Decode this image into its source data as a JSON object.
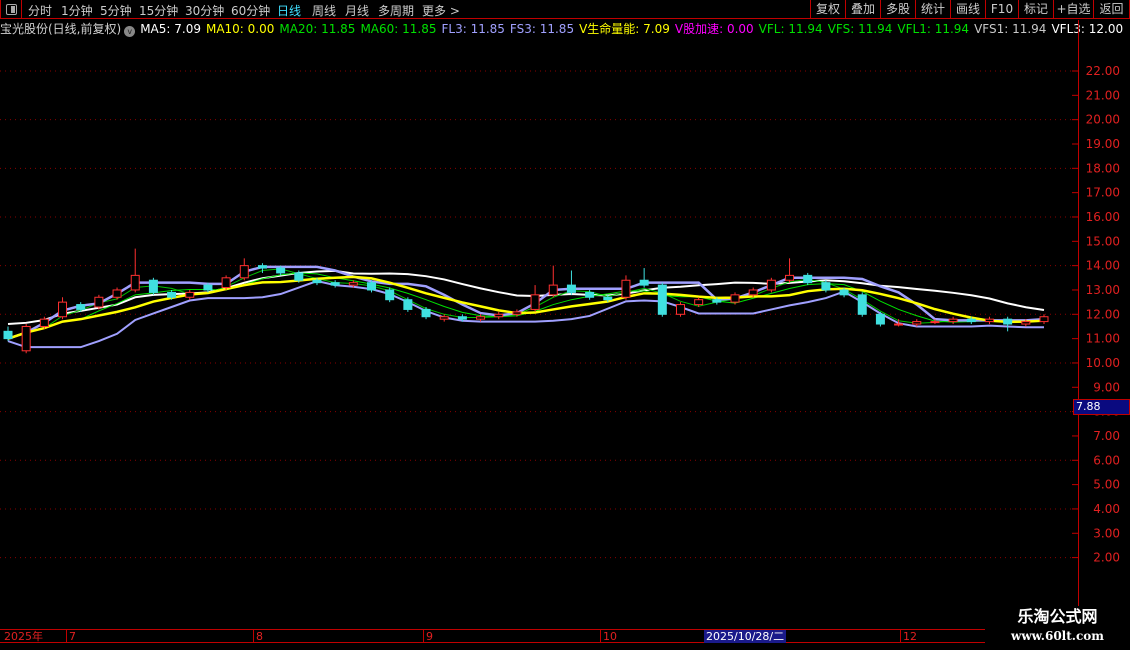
{
  "toolbar": {
    "periods": [
      "分时",
      "1分钟",
      "5分钟",
      "15分钟",
      "30分钟",
      "60分钟",
      "日线",
      "周线",
      "月线",
      "多周期",
      "更多 >"
    ],
    "active_period": "日线",
    "right_buttons": [
      "复权",
      "叠加",
      "多股",
      "统计",
      "画线",
      "F10",
      "标记",
      "+自选",
      "返回"
    ]
  },
  "info": {
    "title": "宝光股份(日线,前复权)",
    "indicators": [
      {
        "text": "MA5: 7.09",
        "color": "#ffffff"
      },
      {
        "text": "MA10: 0.00",
        "color": "#ffff00"
      },
      {
        "text": "MA20: 11.85",
        "color": "#00e000"
      },
      {
        "text": "MA60: 11.85",
        "color": "#00e000"
      },
      {
        "text": "FL3: 11.85",
        "color": "#a0a0ff"
      },
      {
        "text": "FS3: 11.85",
        "color": "#a0a0ff"
      },
      {
        "text": "V生命量能: 7.09",
        "color": "#ffff00"
      },
      {
        "text": "V股加速: 0.00",
        "color": "#ff00ff"
      },
      {
        "text": "VFL: 11.94",
        "color": "#00e000"
      },
      {
        "text": "VFS: 11.94",
        "color": "#00e000"
      },
      {
        "text": "VFL1: 11.94",
        "color": "#00e000"
      },
      {
        "text": "VFS1: 11.94",
        "color": "#c8c8c8"
      },
      {
        "text": "VFL3: 12.00",
        "color": "#ffffff"
      }
    ]
  },
  "last_price": "7.88",
  "dates": {
    "year": "2025年",
    "months": [
      "7",
      "8",
      "9",
      "10",
      "12"
    ],
    "cursor": "2025/10/28/二"
  },
  "watermark": {
    "title": "乐淘公式网",
    "url": "www.60lt.com"
  },
  "colors": {
    "up": "#ff3030",
    "down": "#40e0e0",
    "ma": "#ffff00",
    "band": "#a0a0ff",
    "axis": "#e02020"
  },
  "chart_data": {
    "type": "candlestick",
    "title": "宝光股份(日线,前复权)",
    "ylim": [
      1,
      23
    ],
    "yticks": [
      "22.00",
      "21.00",
      "20.00",
      "19.00",
      "18.00",
      "17.00",
      "16.00",
      "15.00",
      "14.00",
      "13.00",
      "12.00",
      "11.00",
      "10.00",
      "9.00",
      "8.00",
      "7.00",
      "6.00",
      "5.00",
      "4.00",
      "3.00",
      "2.00"
    ],
    "ohlc": [
      [
        11.3,
        11.5,
        10.9,
        11.0
      ],
      [
        10.5,
        11.6,
        10.4,
        11.5
      ],
      [
        11.5,
        11.9,
        11.4,
        11.8
      ],
      [
        11.9,
        12.7,
        11.8,
        12.5
      ],
      [
        12.4,
        12.5,
        12.1,
        12.2
      ],
      [
        12.3,
        12.8,
        12.2,
        12.7
      ],
      [
        12.7,
        13.1,
        12.6,
        13.0
      ],
      [
        13.0,
        14.7,
        12.9,
        13.6
      ],
      [
        13.4,
        13.5,
        12.8,
        12.9
      ],
      [
        12.9,
        13.0,
        12.6,
        12.7
      ],
      [
        12.7,
        13.0,
        12.6,
        12.9
      ],
      [
        13.2,
        13.3,
        12.9,
        13.0
      ],
      [
        13.1,
        13.6,
        13.0,
        13.5
      ],
      [
        13.5,
        14.3,
        13.4,
        14.0
      ],
      [
        14.0,
        14.1,
        13.7,
        13.9
      ],
      [
        13.9,
        14.0,
        13.6,
        13.7
      ],
      [
        13.7,
        13.8,
        13.3,
        13.4
      ],
      [
        13.4,
        13.5,
        13.2,
        13.3
      ],
      [
        13.3,
        13.4,
        13.1,
        13.2
      ],
      [
        13.2,
        13.4,
        13.1,
        13.3
      ],
      [
        13.3,
        13.4,
        12.9,
        13.0
      ],
      [
        13.0,
        13.1,
        12.5,
        12.6
      ],
      [
        12.6,
        12.7,
        12.1,
        12.2
      ],
      [
        12.2,
        12.3,
        11.8,
        11.9
      ],
      [
        11.8,
        12.0,
        11.7,
        11.9
      ],
      [
        11.9,
        12.0,
        11.7,
        11.8
      ],
      [
        11.8,
        12.0,
        11.7,
        11.9
      ],
      [
        11.9,
        12.1,
        11.8,
        12.0
      ],
      [
        12.0,
        12.2,
        11.9,
        12.1
      ],
      [
        12.2,
        13.2,
        12.1,
        12.8
      ],
      [
        12.8,
        14.0,
        12.7,
        13.2
      ],
      [
        13.2,
        13.8,
        12.8,
        12.9
      ],
      [
        12.9,
        13.0,
        12.6,
        12.7
      ],
      [
        12.7,
        12.8,
        12.5,
        12.6
      ],
      [
        12.7,
        13.6,
        12.6,
        13.4
      ],
      [
        13.4,
        13.9,
        13.1,
        13.2
      ],
      [
        13.2,
        13.3,
        11.9,
        12.0
      ],
      [
        12.0,
        12.5,
        11.9,
        12.4
      ],
      [
        12.4,
        12.7,
        12.3,
        12.6
      ],
      [
        12.6,
        12.7,
        12.4,
        12.5
      ],
      [
        12.5,
        12.9,
        12.4,
        12.8
      ],
      [
        12.8,
        13.1,
        12.7,
        13.0
      ],
      [
        13.0,
        13.5,
        12.9,
        13.4
      ],
      [
        13.4,
        14.3,
        13.3,
        13.6
      ],
      [
        13.6,
        13.7,
        13.2,
        13.3
      ],
      [
        13.3,
        13.4,
        12.9,
        13.0
      ],
      [
        13.0,
        13.1,
        12.7,
        12.8
      ],
      [
        12.8,
        12.9,
        11.9,
        12.0
      ],
      [
        12.0,
        12.1,
        11.5,
        11.6
      ],
      [
        11.6,
        11.8,
        11.5,
        11.6
      ],
      [
        11.6,
        11.8,
        11.5,
        11.7
      ],
      [
        11.7,
        11.8,
        11.6,
        11.7
      ],
      [
        11.7,
        11.9,
        11.6,
        11.8
      ],
      [
        11.8,
        11.9,
        11.6,
        11.7
      ],
      [
        11.7,
        11.9,
        11.6,
        11.8
      ],
      [
        11.8,
        11.9,
        11.3,
        11.6
      ],
      [
        11.6,
        11.8,
        11.5,
        11.7
      ],
      [
        11.7,
        12.0,
        11.6,
        11.9
      ]
    ]
  }
}
